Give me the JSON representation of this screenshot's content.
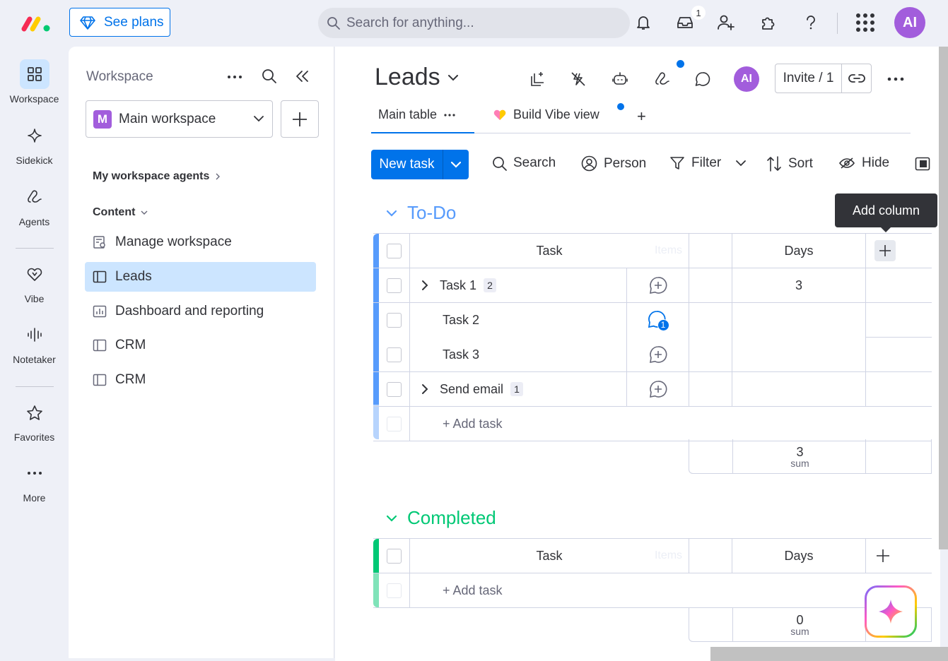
{
  "topbar": {
    "see_plans": "See plans",
    "search_placeholder": "Search for anything...",
    "inbox_badge": "1",
    "avatar": "AI"
  },
  "rail": [
    {
      "label": "Workspace",
      "icon": "grid-icon"
    },
    {
      "label": "Sidekick",
      "icon": "sparkle-icon"
    },
    {
      "label": "Agents",
      "icon": "agents-icon"
    },
    {
      "label": "Vibe",
      "icon": "heart-icon"
    },
    {
      "label": "Notetaker",
      "icon": "waveform-icon"
    },
    {
      "label": "Favorites",
      "icon": "star-icon"
    },
    {
      "label": "More",
      "icon": "more-dots-icon"
    }
  ],
  "workspace": {
    "title": "Workspace",
    "selected": "Main workspace",
    "logo_letter": "M",
    "agents_label": "My workspace agents",
    "content_label": "Content",
    "items": [
      {
        "label": "Manage workspace",
        "icon": "manage-icon"
      },
      {
        "label": "Leads",
        "icon": "board-icon"
      },
      {
        "label": "Dashboard and reporting",
        "icon": "dashboard-icon"
      },
      {
        "label": "CRM",
        "icon": "board-icon"
      },
      {
        "label": "CRM",
        "icon": "board-icon"
      }
    ]
  },
  "board": {
    "title": "Leads",
    "avatar": "AI",
    "invite": "Invite / 1",
    "tabs": [
      "Main table",
      "Build Vibe view"
    ],
    "add_tab": "+"
  },
  "toolbar": {
    "new_task": "New task",
    "search": "Search",
    "person": "Person",
    "filter": "Filter",
    "sort": "Sort",
    "hide": "Hide"
  },
  "tooltip": "Add column",
  "groups": [
    {
      "title": "To-Do",
      "color": "#579bfc",
      "columns": {
        "task": "Task",
        "items": "Items",
        "days": "Days"
      },
      "rows": [
        {
          "name": "Task 1",
          "count": "2",
          "days": "3"
        },
        {
          "name": "Task 2",
          "count": "",
          "days": "",
          "updates": "1"
        },
        {
          "name": "Task 3",
          "count": "",
          "days": ""
        },
        {
          "name": "Send email",
          "count": "1",
          "days": ""
        }
      ],
      "add_task": "+ Add task",
      "sum_value": "3",
      "sum_label": "sum"
    },
    {
      "title": "Completed",
      "color": "#00c875",
      "columns": {
        "task": "Task",
        "items": "Items",
        "days": "Days"
      },
      "rows": [],
      "add_task": "+ Add task",
      "sum_value": "0",
      "sum_label": "sum"
    }
  ]
}
